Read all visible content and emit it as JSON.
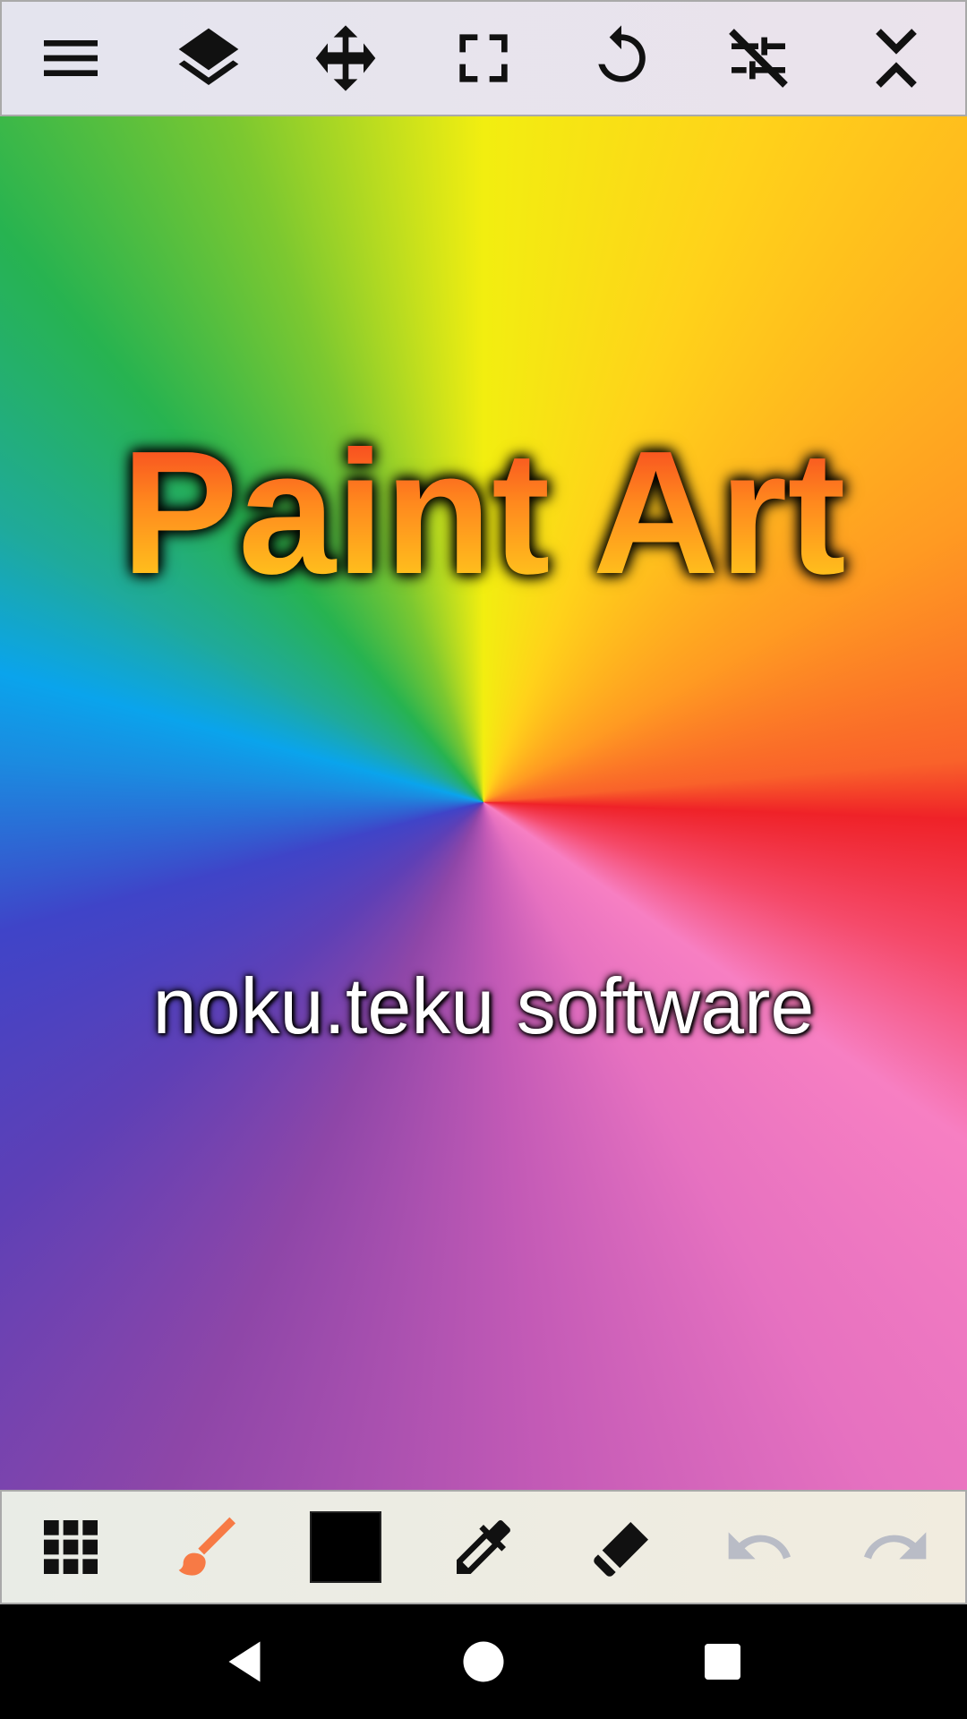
{
  "canvas": {
    "title": "Paint Art",
    "subtitle": "noku.teku software"
  },
  "top_toolbar": {
    "icons": [
      "menu-icon",
      "layers-icon",
      "move-icon",
      "fullscreen-icon",
      "rotate-icon",
      "adjust-off-icon",
      "collapse-icon"
    ]
  },
  "bottom_toolbar": {
    "icons": [
      "grid-icon",
      "brush-icon",
      "color-swatch",
      "eyedropper-icon",
      "eraser-icon",
      "undo-icon",
      "redo-icon"
    ],
    "active_tool_color": "#f77a45",
    "current_color": "#000000",
    "disabled_color": "#b9bcc6"
  },
  "nav_bar": {
    "icons": [
      "back-icon",
      "home-icon",
      "recents-icon"
    ]
  }
}
